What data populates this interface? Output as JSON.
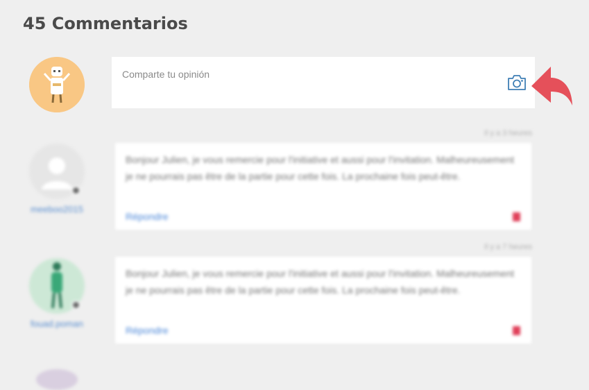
{
  "header": {
    "title": "45 Commentarios"
  },
  "composer": {
    "placeholder": "Comparte tu opinión",
    "camera_icon": "camera-icon",
    "hint_arrow_color": "#e5505a"
  },
  "comments": [
    {
      "username": "meeboo2015",
      "time": "Il y a 3 heures",
      "text": "Bonjour Julien, je vous remercie pour l'initiative et aussi pour l'invitation. Malheureusement je ne pourrais pas être de la partie pour cette fois. La prochaine fois peut-être.",
      "reply_label": "Répondre"
    },
    {
      "username": "fouad.poman",
      "time": "Il y a 7 heures",
      "text": "Bonjour Julien, je vous remercie pour l'initiative et aussi pour l'invitation. Malheureusement je ne pourrais pas être de la partie pour cette fois. La prochaine fois peut-être.",
      "reply_label": "Répondre"
    }
  ],
  "colors": {
    "background": "#efefef",
    "card": "#ffffff",
    "link": "#4a86d8",
    "delete": "#e0405a",
    "camera": "#3f7fb5"
  }
}
